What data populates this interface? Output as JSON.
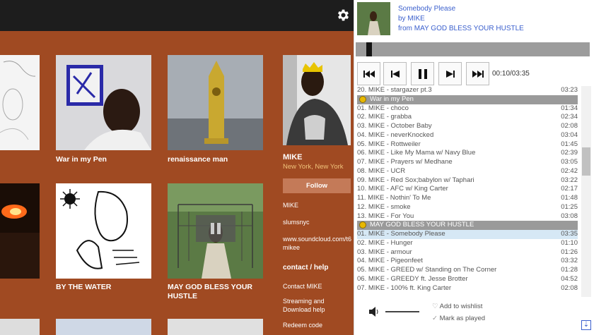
{
  "colors": {
    "page_bg": "#a04a22",
    "link": "#3a5fcd",
    "location": "#f0c27a",
    "group_header": "#9a9a9a",
    "highlight_row": "#d6e8f5"
  },
  "header": {
    "settings_icon": "gear-icon"
  },
  "albums": [
    {
      "title": "War in my Pen"
    },
    {
      "title": "renaissance man"
    },
    {
      "title": "BY THE WATER"
    },
    {
      "title": "MAY GOD BLESS YOUR HUSTLE"
    }
  ],
  "artist": {
    "name": "MIKE",
    "location": "New York, New York",
    "follow_label": "Follow",
    "links": [
      "MIKE",
      "slumsnyc",
      "www.soundcloud.com/t6mikee"
    ],
    "contact_heading": "contact / help",
    "contact_links": [
      "Contact MIKE",
      "Streaming and Download help",
      "Redeem code"
    ]
  },
  "player": {
    "track_title": "Somebody Please",
    "by_line": "by MIKE",
    "from_line": "from MAY GOD BLESS YOUR HUSTLE",
    "time": "00:10/03:35",
    "progress_fraction": 0.047,
    "controls": [
      "first-track-icon",
      "previous-icon",
      "pause-icon",
      "next-icon",
      "last-track-icon"
    ],
    "prev_tail": {
      "label": "20. MIKE - stargazer pt.3",
      "duration": "03:23"
    },
    "groups": [
      {
        "name": "War in my Pen",
        "tracks": [
          {
            "label": "01. MIKE - choco",
            "duration": "01:34"
          },
          {
            "label": "02. MIKE - grabba",
            "duration": "02:34"
          },
          {
            "label": "03. MIKE - October Baby",
            "duration": "02:08"
          },
          {
            "label": "04. MIKE - neverKnocked",
            "duration": "03:04"
          },
          {
            "label": "05. MIKE - Rottweiler",
            "duration": "01:45"
          },
          {
            "label": "06. MIKE - Like My Mama w/ Navy Blue",
            "duration": "02:39"
          },
          {
            "label": "07. MIKE - Prayers w/ Medhane",
            "duration": "03:05"
          },
          {
            "label": "08. MIKE - UCR",
            "duration": "02:42"
          },
          {
            "label": "09. MIKE - Red Sox;babylon w/ Taphari",
            "duration": "03:22"
          },
          {
            "label": "10. MIKE - AFC w/ King Carter",
            "duration": "02:17"
          },
          {
            "label": "11. MIKE - Nothin' To Me",
            "duration": "01:48"
          },
          {
            "label": "12. MIKE - smoke",
            "duration": "01:25"
          },
          {
            "label": "13. MIKE - For You",
            "duration": "03:08"
          }
        ]
      },
      {
        "name": "MAY GOD BLESS YOUR HUSTLE",
        "tracks": [
          {
            "label": "01. MIKE - Somebody Please",
            "duration": "03:35",
            "playing": true
          },
          {
            "label": "02. MIKE - Hunger",
            "duration": "01:10"
          },
          {
            "label": "03. MIKE - armour",
            "duration": "01:26"
          },
          {
            "label": "04. MIKE - Pigeonfeet",
            "duration": "03:32"
          },
          {
            "label": "05. MIKE - GREED w/ Standing on The Corner",
            "duration": "01:28"
          },
          {
            "label": "06. MIKE - GREEDY ft. Jesse Brotter",
            "duration": "04:52"
          },
          {
            "label": "07. MIKE - 100% ft. King Carter",
            "duration": "02:08"
          }
        ]
      }
    ],
    "volume_fraction": 0.55,
    "wishlist_label": "Add to wishlist",
    "mark_played_label": "Mark as played"
  }
}
